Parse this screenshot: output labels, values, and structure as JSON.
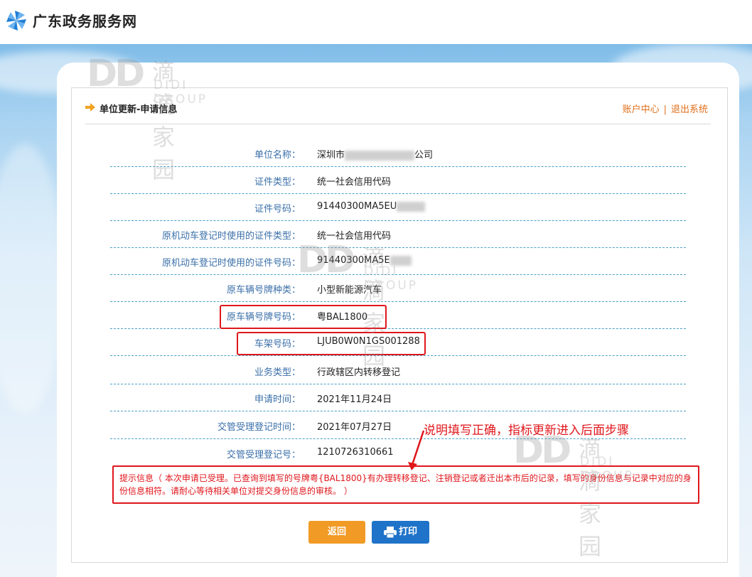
{
  "header": {
    "site_title": "广东政务服务网",
    "logo_icon": "pinwheel-logo-icon"
  },
  "section": {
    "title": "单位更新-申请信息",
    "links": {
      "account": "账户中心",
      "separator": "|",
      "logout": "退出系统"
    }
  },
  "fields": [
    {
      "label": "单位名称：",
      "value_prefix": "深圳市",
      "value_suffix": "公司"
    },
    {
      "label": "证件类型：",
      "value": "统一社会信用代码"
    },
    {
      "label": "证件号码：",
      "value_prefix": "91440300MA5EU"
    },
    {
      "label": "原机动车登记时使用的证件类型：",
      "value": "统一社会信用代码"
    },
    {
      "label": "原机动车登记时使用的证件号码：",
      "value_prefix": "91440300MA5E"
    },
    {
      "label": "原车辆号牌种类：",
      "value": "小型新能源汽车"
    },
    {
      "label": "原车辆号牌号码：",
      "value": "粤BAL1800"
    },
    {
      "label": "车架号码：",
      "value": "LJUB0W0N1GS001288"
    },
    {
      "label": "业务类型：",
      "value": "行政辖区内转移登记"
    },
    {
      "label": "申请时间：",
      "value": "2021年11月24日"
    },
    {
      "label": "交管受理登记时间：",
      "value": "2021年07月27日"
    },
    {
      "label": "交管受理登记号：",
      "value": "1210726310661"
    }
  ],
  "notice": {
    "text": "提示信息（ 本次申请已受理。已查询到填写的号牌粤{BAL1800}有办理转移登记、注销登记或者迁出本市后的记录，填写的身份信息与记录中对应的身份信息相符。请耐心等待相关单位对提交身份信息的审核。 ）"
  },
  "annotation": {
    "text": "说明填写正确，指标更新进入后面步骤"
  },
  "buttons": {
    "back": "返回",
    "print": "打印"
  },
  "watermark": {
    "mark": "DD",
    "cn": "滴滴家园",
    "en": "DIDI GROUP"
  },
  "colors": {
    "accent_orange": "#f19a25",
    "print_blue": "#1f73c8",
    "highlight_red": "#e0161b",
    "label_blue": "#3a6fa8",
    "link_orange": "#e0701c"
  }
}
